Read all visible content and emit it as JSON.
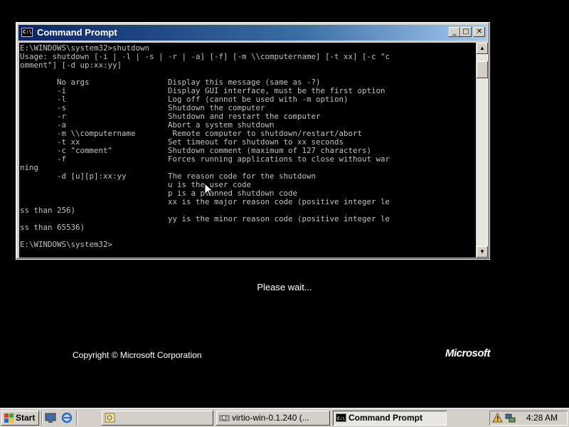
{
  "window": {
    "title": "Command Prompt",
    "icon": "cmd-icon",
    "console_text": "E:\\WINDOWS\\system32>shutdown\nUsage: shutdown [-i | -l | -s | -r | -a] [-f] [-m \\\\computername] [-t xx] [-c \"c\nomment\"] [-d up:xx:yy]\n\n        No args                 Display this message (same as -?)\n        -i                      Display GUI interface, must be the first option\n        -l                      Log off (cannot be used with -m option)\n        -s                      Shutdown the computer\n        -r                      Shutdown and restart the computer\n        -a                      Abort a system shutdown\n        -m \\\\computername        Remote computer to shutdown/restart/abort\n        -t xx                   Set timeout for shutdown to xx seconds\n        -c \"comment\"            Shutdown comment (maximum of 127 characters)\n        -f                      Forces running applications to close without war\nning\n        -d [u][p]:xx:yy         The reason code for the shutdown\n                                u is the user code\n                                p is a planned shutdown code\n                                xx is the major reason code (positive integer le\nss than 256)\n                                yy is the minor reason code (positive integer le\nss than 65536)\n\nE:\\WINDOWS\\system32>"
  },
  "screen": {
    "please_wait": "Please wait...",
    "copyright": "Copyright © Microsoft Corporation",
    "logo_text": "Microsoft"
  },
  "taskbar": {
    "start_label": "Start",
    "tasks": [
      {
        "label": "",
        "icon": "explorer-icon"
      },
      {
        "label": "virtio-win-0.1.240 (...",
        "icon": "drive-icon"
      },
      {
        "label": "Command Prompt",
        "icon": "cmd-icon",
        "active": true
      }
    ],
    "clock": "4:28 AM"
  }
}
